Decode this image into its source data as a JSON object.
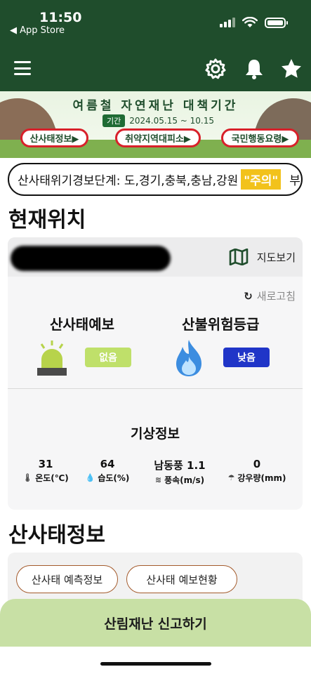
{
  "status_bar": {
    "time": "11:50",
    "back_label": "◀ App Store"
  },
  "header": {
    "icons": [
      "menu-icon",
      "gear-icon",
      "bell-icon",
      "star-icon"
    ],
    "background_color": "#1f4d2c"
  },
  "banner": {
    "title": "여름철 자연재난 대책기간",
    "period_tag": "기간",
    "period_text": "2024.05.15 ~ 10.15",
    "buttons": [
      {
        "label": "산사태정보▶"
      },
      {
        "label": "취약지역대피소▶"
      },
      {
        "label": "국민행동요령▶"
      }
    ]
  },
  "ticker": {
    "text": "산사태위기경보단계: 도,경기,충북,충남,강원",
    "level": "\"주의\"",
    "overflow_char": "부"
  },
  "current_location": {
    "title": "현재위치",
    "map_button": "지도보기",
    "refresh_label": "새로고침",
    "landslide_forecast": {
      "title": "산사태예보",
      "status": "없음",
      "status_color": "#bfe06a"
    },
    "fire_risk": {
      "title": "산불위험등급",
      "status": "낮음",
      "status_color": "#2035c8"
    },
    "weather": {
      "title": "기상정보",
      "items": [
        {
          "value": "31",
          "label": "온도(℃)",
          "icon": "thermometer-icon"
        },
        {
          "value": "64",
          "label": "습도(%)",
          "icon": "humidity-icon"
        },
        {
          "value": "남동풍 1.1",
          "label": "풍속(m/s)",
          "icon": "wind-icon"
        },
        {
          "value": "0",
          "label": "강우량(mm)",
          "icon": "rain-icon"
        }
      ]
    }
  },
  "landslide_info": {
    "title": "산사태정보",
    "buttons": [
      {
        "label": "산사태 예측정보"
      },
      {
        "label": "산사태 예보현황"
      }
    ]
  },
  "report_button": {
    "label": "산림재난 신고하기",
    "color": "#c8e0a5"
  }
}
